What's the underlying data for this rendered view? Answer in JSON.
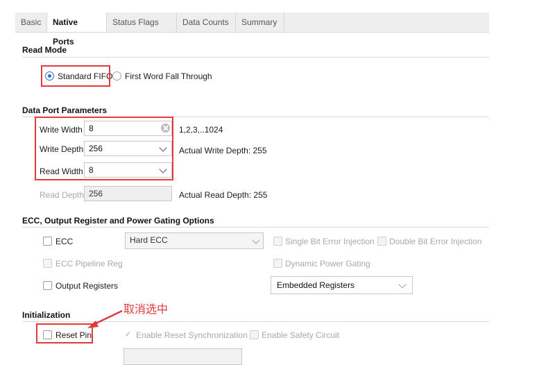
{
  "tabs": [
    {
      "label": "Basic"
    },
    {
      "label": "Native Ports"
    },
    {
      "label": "Status Flags"
    },
    {
      "label": "Data Counts"
    },
    {
      "label": "Summary"
    }
  ],
  "read_mode": {
    "title": "Read Mode",
    "standard_fifo": "Standard FIFO",
    "fwft": "First Word Fall Through",
    "selected": "Standard FIFO"
  },
  "data_port": {
    "title": "Data Port Parameters",
    "write_width_label": "Write Width",
    "write_width_value": "8",
    "write_width_range": "1,2,3,..1024",
    "write_depth_label": "Write Depth",
    "write_depth_value": "256",
    "write_depth_actual": "Actual Write Depth: 255",
    "read_width_label": "Read Width",
    "read_width_value": "8",
    "read_depth_label": "Read Depth",
    "read_depth_value": "256",
    "read_depth_actual": "Actual Read Depth: 255"
  },
  "ecc": {
    "title": "ECC, Output Register and Power Gating Options",
    "ecc_label": "ECC",
    "ecc_type": "Hard ECC",
    "single_bit": "Single Bit Error Injection",
    "double_bit": "Double Bit Error Injection",
    "ecc_pipeline": "ECC Pipeline Reg",
    "dynamic_power": "Dynamic Power Gating",
    "output_registers": "Output Registers",
    "output_reg_type": "Embedded Registers"
  },
  "init": {
    "title": "Initialization",
    "reset_pin": "Reset Pin",
    "enable_reset_sync": "Enable Reset Synchronization",
    "enable_safety": "Enable Safety Circuit"
  },
  "annotation": {
    "text": "取消选中",
    "color": "#e03a3a"
  }
}
